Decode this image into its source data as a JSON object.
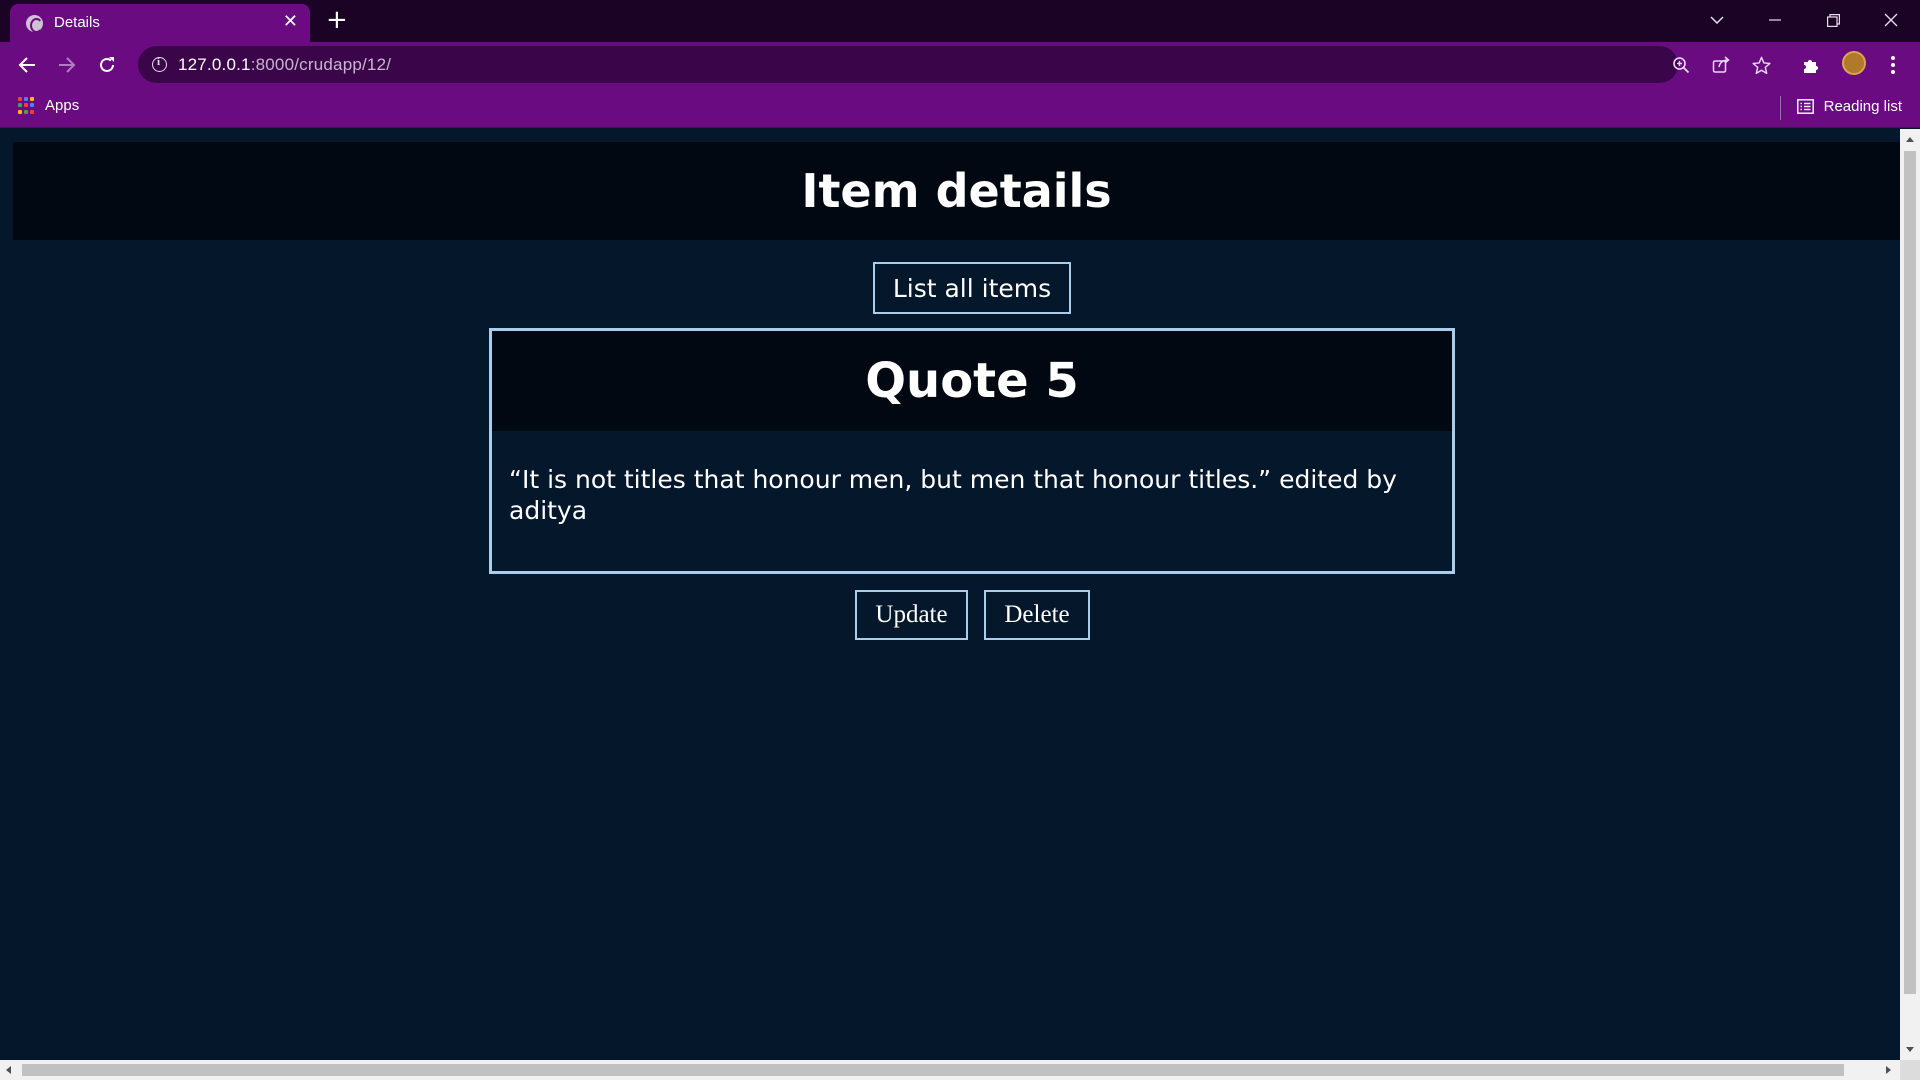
{
  "browser": {
    "tab_title": "Details",
    "tab_close": "✕",
    "new_tab": "+",
    "url_host": "127.0.0.1",
    "url_rest": ":8000/crudapp/12/",
    "bookmarks_apps_label": "Apps",
    "reading_list_label": "Reading list",
    "theme_color": "#6b0b82"
  },
  "page": {
    "title": "Item details",
    "list_button": "List all items",
    "item": {
      "title": "Quote 5",
      "body": "“It is not titles that honour men, but men that honour titles.” edited by aditya"
    },
    "update_button": "Update",
    "delete_button": "Delete",
    "accent_color": "#a9cdeb",
    "background_color": "#04172b"
  }
}
